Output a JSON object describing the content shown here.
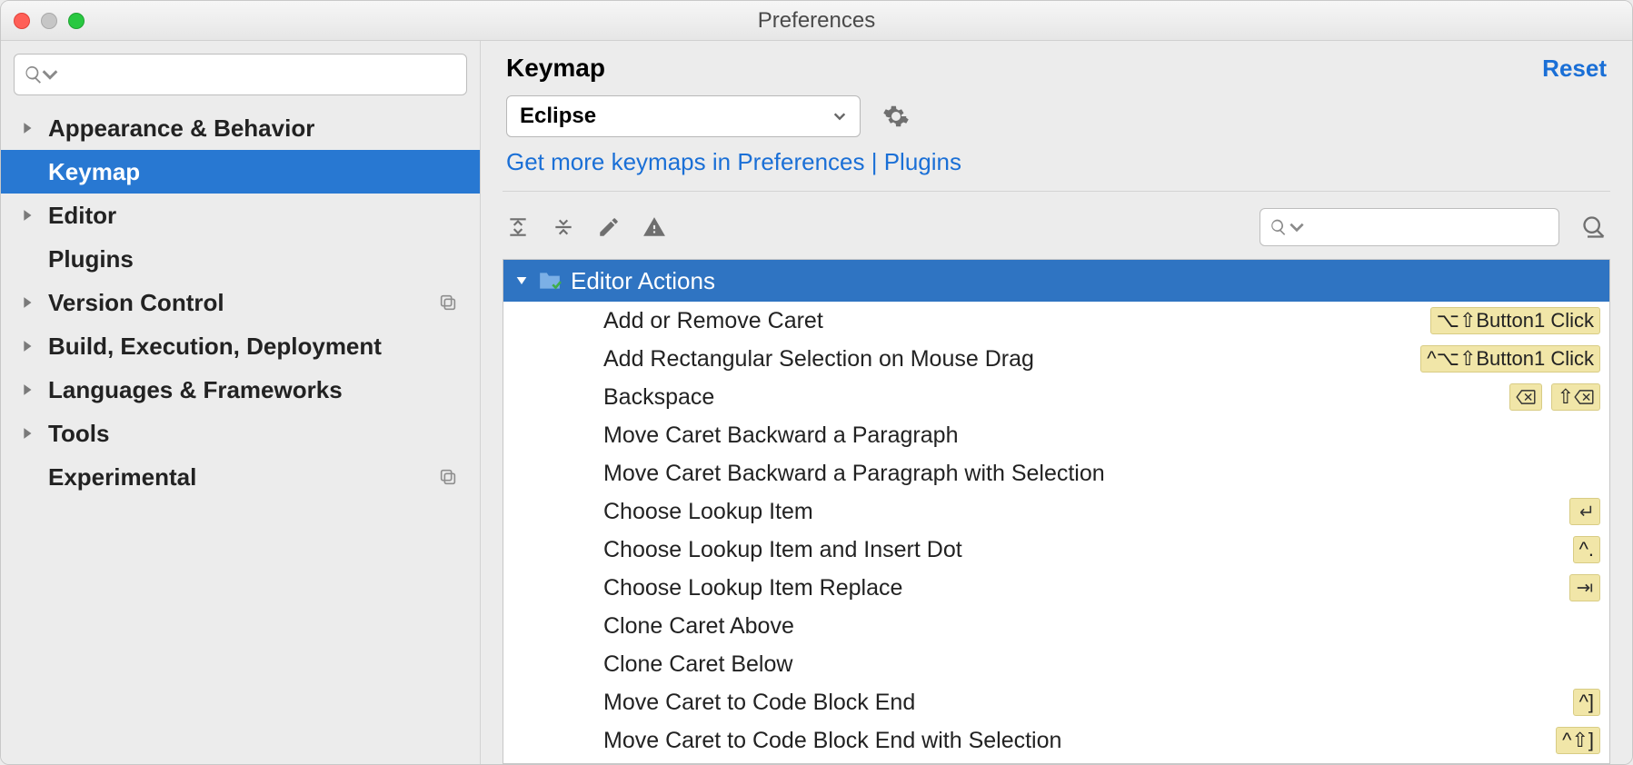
{
  "window": {
    "title": "Preferences"
  },
  "sidebar": {
    "search_placeholder": "",
    "items": [
      {
        "label": "Appearance & Behavior",
        "expandable": true
      },
      {
        "label": "Keymap",
        "expandable": false,
        "selected": true
      },
      {
        "label": "Editor",
        "expandable": true
      },
      {
        "label": "Plugins",
        "expandable": false
      },
      {
        "label": "Version Control",
        "expandable": true,
        "copy": true
      },
      {
        "label": "Build, Execution, Deployment",
        "expandable": true
      },
      {
        "label": "Languages & Frameworks",
        "expandable": true
      },
      {
        "label": "Tools",
        "expandable": true
      },
      {
        "label": "Experimental",
        "expandable": false,
        "copy": true
      }
    ]
  },
  "main": {
    "title": "Keymap",
    "reset": "Reset",
    "scheme": "Eclipse",
    "hint": "Get more keymaps in Preferences | Plugins",
    "search_placeholder": "",
    "group": "Editor Actions",
    "actions": [
      {
        "name": "Add or Remove Caret",
        "shortcuts": [
          "⌥⇧Button1 Click"
        ]
      },
      {
        "name": "Add Rectangular Selection on Mouse Drag",
        "shortcuts": [
          "^⌥⇧Button1 Click"
        ]
      },
      {
        "name": "Backspace",
        "shortcuts": [
          "⌫",
          "⇧⌫"
        ]
      },
      {
        "name": "Move Caret Backward a Paragraph",
        "shortcuts": []
      },
      {
        "name": "Move Caret Backward a Paragraph with Selection",
        "shortcuts": []
      },
      {
        "name": "Choose Lookup Item",
        "shortcuts": [
          "⏎"
        ]
      },
      {
        "name": "Choose Lookup Item and Insert Dot",
        "shortcuts": [
          "^."
        ]
      },
      {
        "name": "Choose Lookup Item Replace",
        "shortcuts": [
          "⇥"
        ]
      },
      {
        "name": "Clone Caret Above",
        "shortcuts": []
      },
      {
        "name": "Clone Caret Below",
        "shortcuts": []
      },
      {
        "name": "Move Caret to Code Block End",
        "shortcuts": [
          "^]"
        ]
      },
      {
        "name": "Move Caret to Code Block End with Selection",
        "shortcuts": [
          "^⇧]"
        ]
      }
    ]
  }
}
